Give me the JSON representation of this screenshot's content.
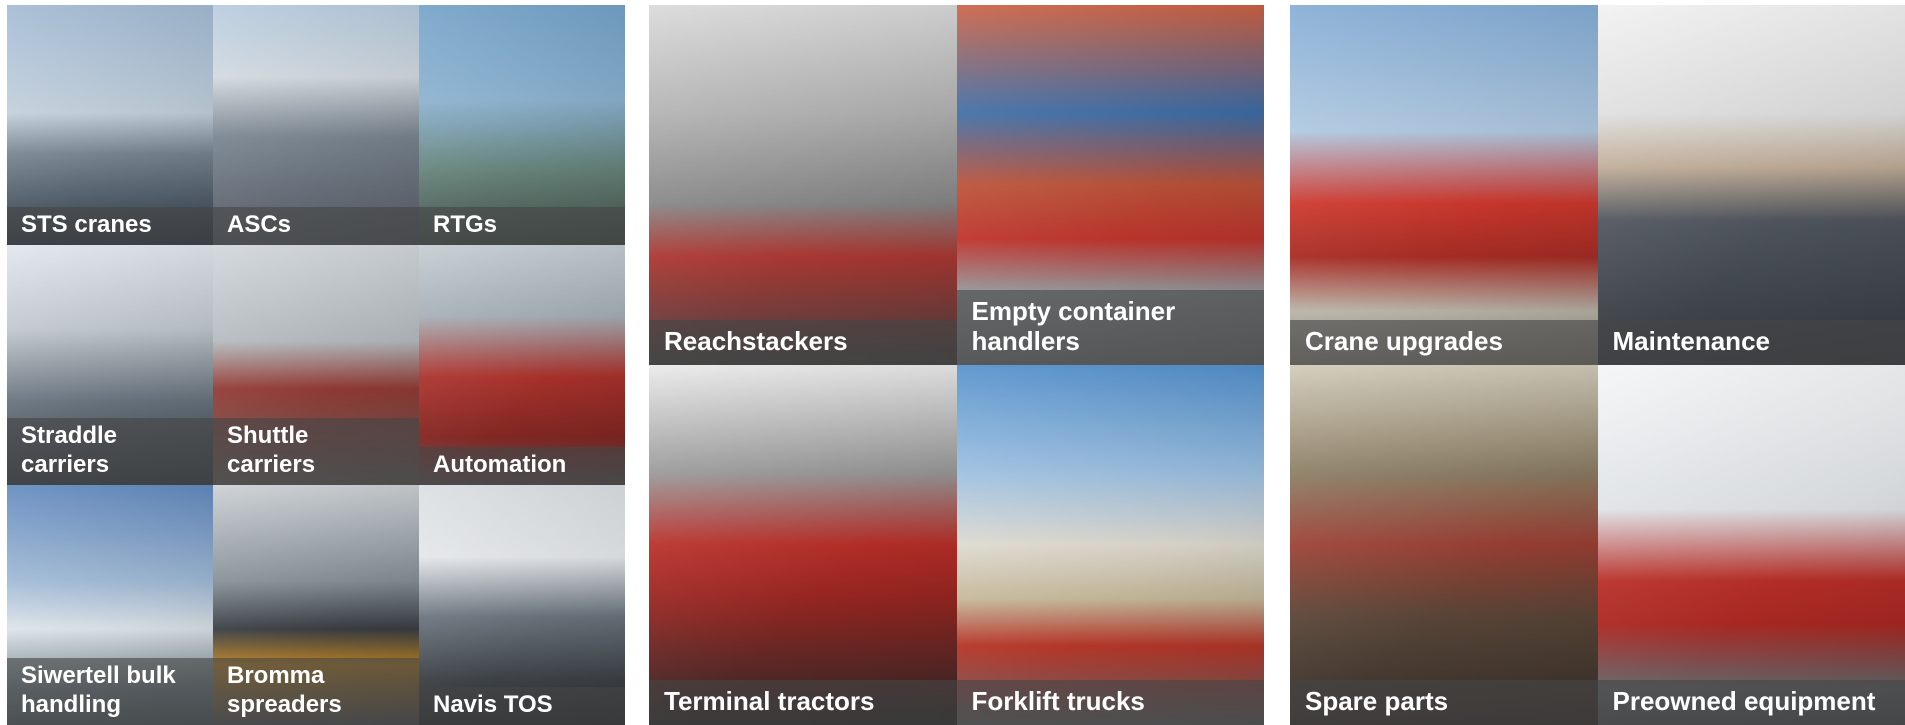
{
  "panels": [
    {
      "tiles": [
        {
          "caption": [
            "STS cranes"
          ]
        },
        {
          "caption": [
            "ASCs"
          ]
        },
        {
          "caption": [
            "RTGs"
          ]
        },
        {
          "caption": [
            "Straddle",
            "carriers"
          ]
        },
        {
          "caption": [
            "Shuttle",
            "carriers"
          ]
        },
        {
          "caption": [
            "Automation"
          ]
        },
        {
          "caption": [
            "Siwertell bulk",
            "handling"
          ]
        },
        {
          "caption": [
            "Bromma",
            "spreaders"
          ]
        },
        {
          "caption": [
            "Navis TOS"
          ]
        }
      ]
    },
    {
      "tiles": [
        {
          "caption": [
            "Reachstackers"
          ]
        },
        {
          "caption": [
            "Empty container",
            "handlers"
          ]
        },
        {
          "caption": [
            "Terminal tractors"
          ]
        },
        {
          "caption": [
            "Forklift trucks"
          ]
        }
      ]
    },
    {
      "tiles": [
        {
          "caption": [
            "Crane upgrades"
          ]
        },
        {
          "caption": [
            "Maintenance"
          ]
        },
        {
          "caption": [
            "Spare parts"
          ]
        },
        {
          "caption": [
            "Preowned equipment"
          ]
        }
      ]
    }
  ]
}
